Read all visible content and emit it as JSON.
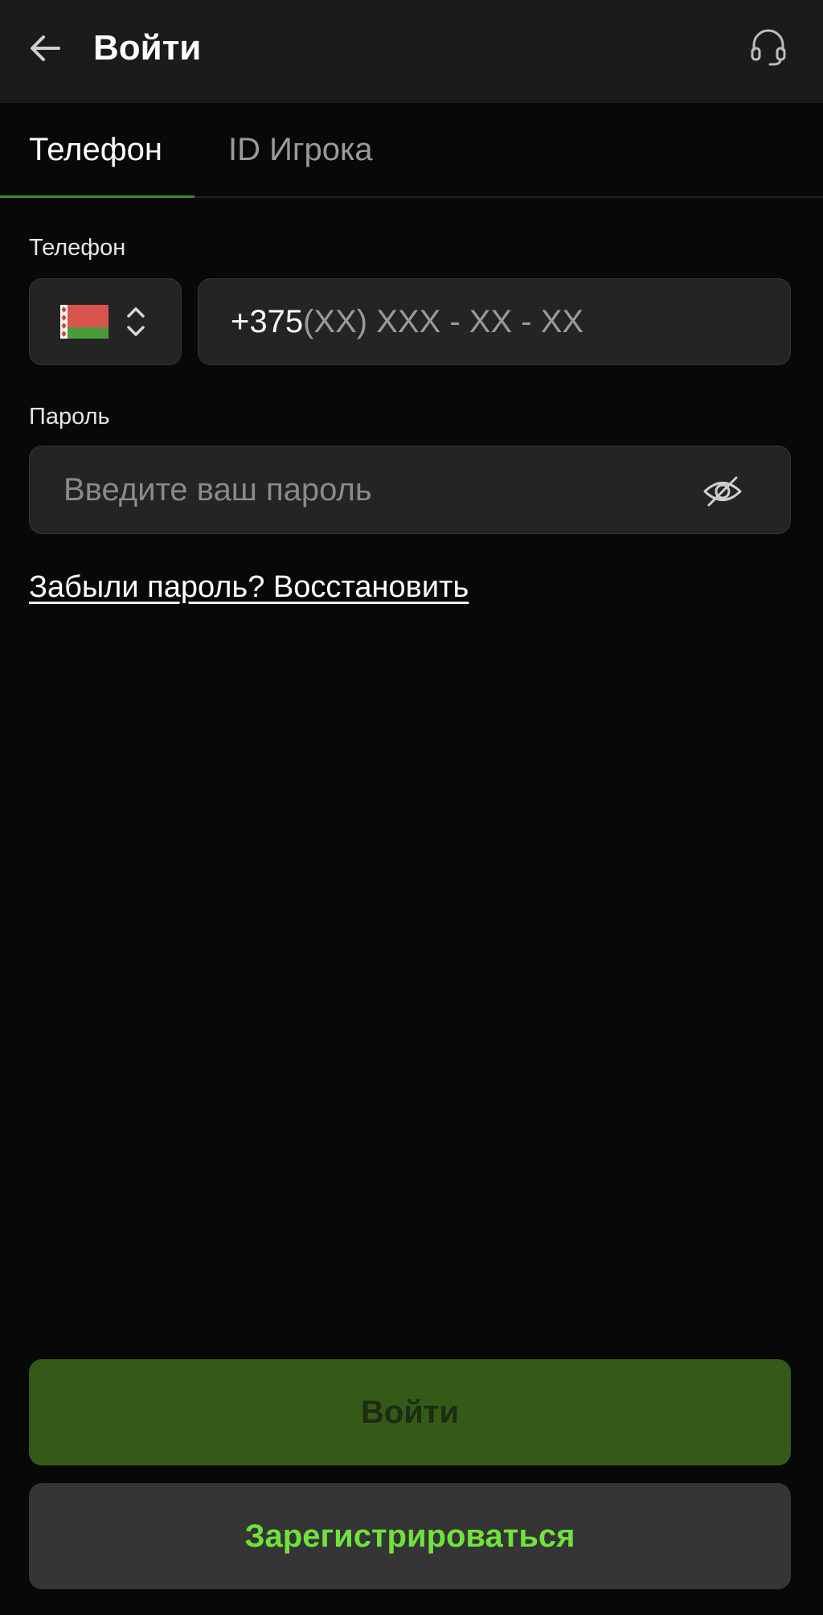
{
  "header": {
    "back_icon": "arrow-left-icon",
    "title": "Войти",
    "support_icon": "headset-icon"
  },
  "tabs": [
    {
      "label": "Телефон",
      "active": true
    },
    {
      "label": "ID Игрока",
      "active": false
    }
  ],
  "phone": {
    "label": "Телефон",
    "country_flag_icon": "belarus-flag-icon",
    "selector_icon": "chevron-up-down-icon",
    "prefix": "+375",
    "mask": "(XX) XXX - XX - XX"
  },
  "password": {
    "label": "Пароль",
    "placeholder": "Введите ваш пароль",
    "visibility_icon": "eye-off-icon"
  },
  "forgot_link": "Забыли пароль? Восстановить",
  "buttons": {
    "login": "Войти",
    "register": "Зарегистрироваться"
  },
  "colors": {
    "accent_green": "#6fe23c",
    "login_button_bg": "#355a18",
    "tab_underline": "#3e8a2e"
  }
}
